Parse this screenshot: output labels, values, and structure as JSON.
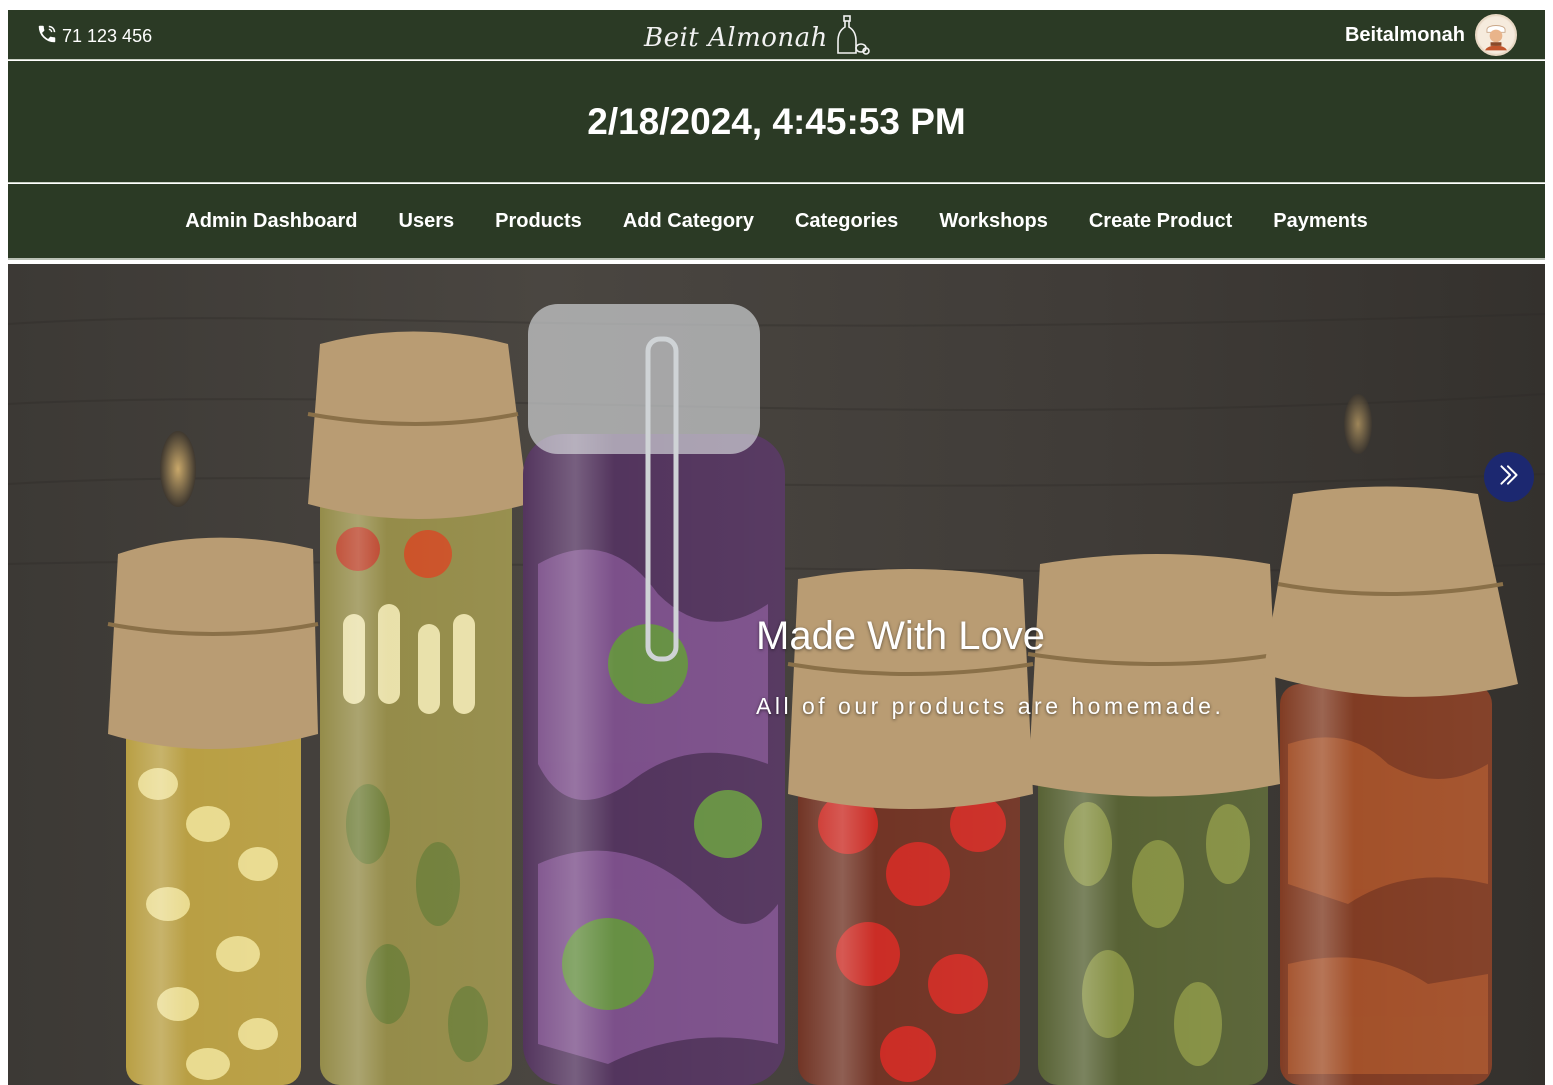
{
  "header": {
    "phone": "71 123 456",
    "logo_text": "Beit Almonah",
    "username": "Beitalmonah"
  },
  "datetime": "2/18/2024, 4:45:53 PM",
  "nav": {
    "items": [
      {
        "label": "Admin Dashboard"
      },
      {
        "label": "Users"
      },
      {
        "label": "Products"
      },
      {
        "label": "Add Category"
      },
      {
        "label": "Categories"
      },
      {
        "label": "Workshops"
      },
      {
        "label": "Create Product"
      },
      {
        "label": "Payments"
      }
    ]
  },
  "hero": {
    "title": "Made With Love",
    "subtitle": "All of our products are homemade."
  },
  "colors": {
    "header_bg": "#2b3a25",
    "carousel_button": "#1c2870"
  },
  "icons": {
    "phone": "phone-icon",
    "logo": "oil-bottle-logo-icon",
    "avatar": "avatar",
    "next": "double-chevron-right-icon"
  }
}
